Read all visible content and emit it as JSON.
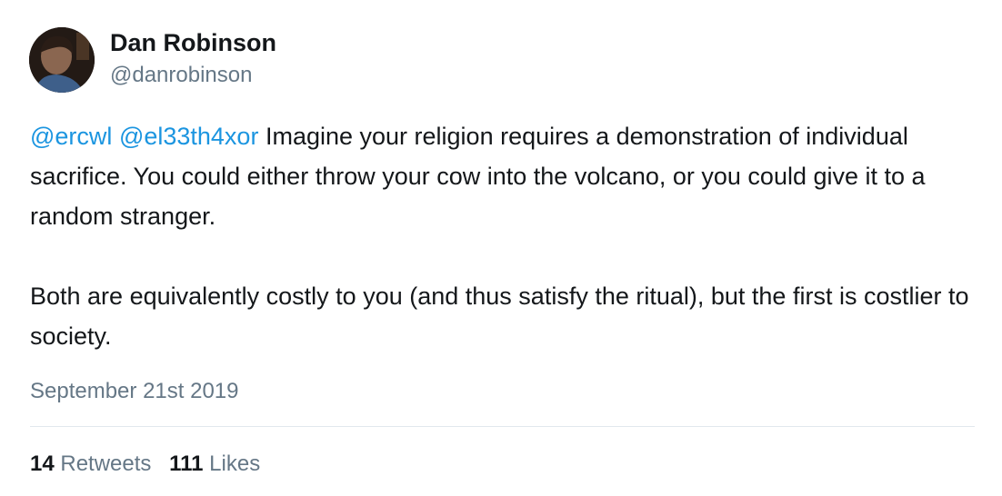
{
  "author": {
    "display_name": "Dan Robinson",
    "handle": "@danrobinson"
  },
  "tweet": {
    "paragraph1": {
      "mention1": "@ercwl",
      "mention2": "@el33th4xor",
      "text": "Imagine your religion requires a demonstration of individual sacrifice. You could either throw your cow into the volcano, or you could give it to a random stranger."
    },
    "paragraph2": "Both are equivalently costly to you (and thus satisfy the ritual), but the first is costlier to society.",
    "timestamp": "September 21st 2019"
  },
  "stats": {
    "retweets_count": "14",
    "retweets_label": "Retweets",
    "likes_count": "111",
    "likes_label": "Likes"
  },
  "colors": {
    "mention": "#1b95e0",
    "muted": "#657786",
    "text": "#14171a",
    "divider": "#e1e8ed"
  }
}
